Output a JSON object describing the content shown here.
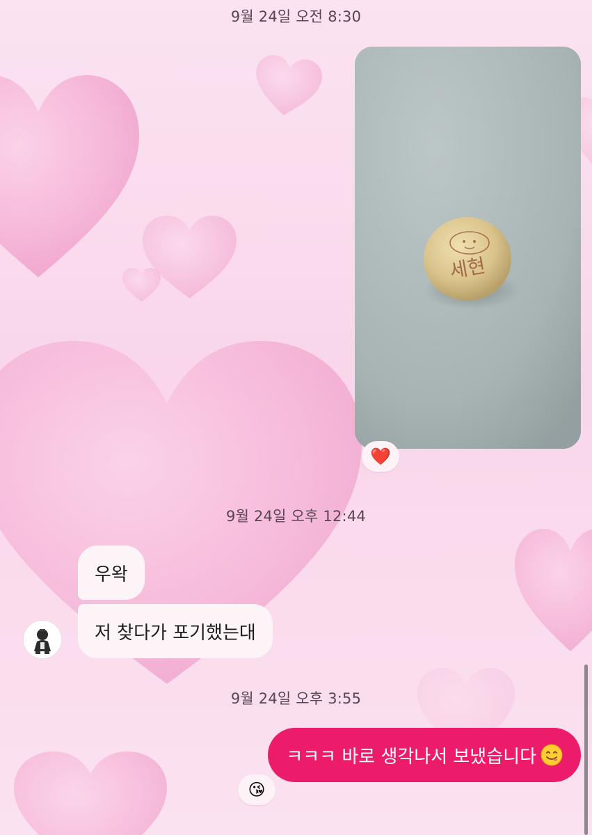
{
  "timestamps": {
    "t1": "9월 24일 오전 8:30",
    "t2": "9월 24일 오후 12:44",
    "t3": "9월 24일 오후 3:55"
  },
  "photo": {
    "icon": "photo-of-cookie",
    "engraved_text": "세현"
  },
  "reactions": {
    "photo": "❤️",
    "last_message": "😘"
  },
  "incoming": [
    {
      "text": "우왁"
    },
    {
      "text": "저 찾다가 포기했는대"
    }
  ],
  "outgoing": {
    "text": "ㅋㅋㅋ 바로 생각나서 보냈습니다",
    "emoji": "yum-face-icon"
  },
  "colors": {
    "outgoing_bubble": "#ec1c6b",
    "incoming_bubble": "#fdf4f7",
    "background": "#fbe3f1"
  }
}
